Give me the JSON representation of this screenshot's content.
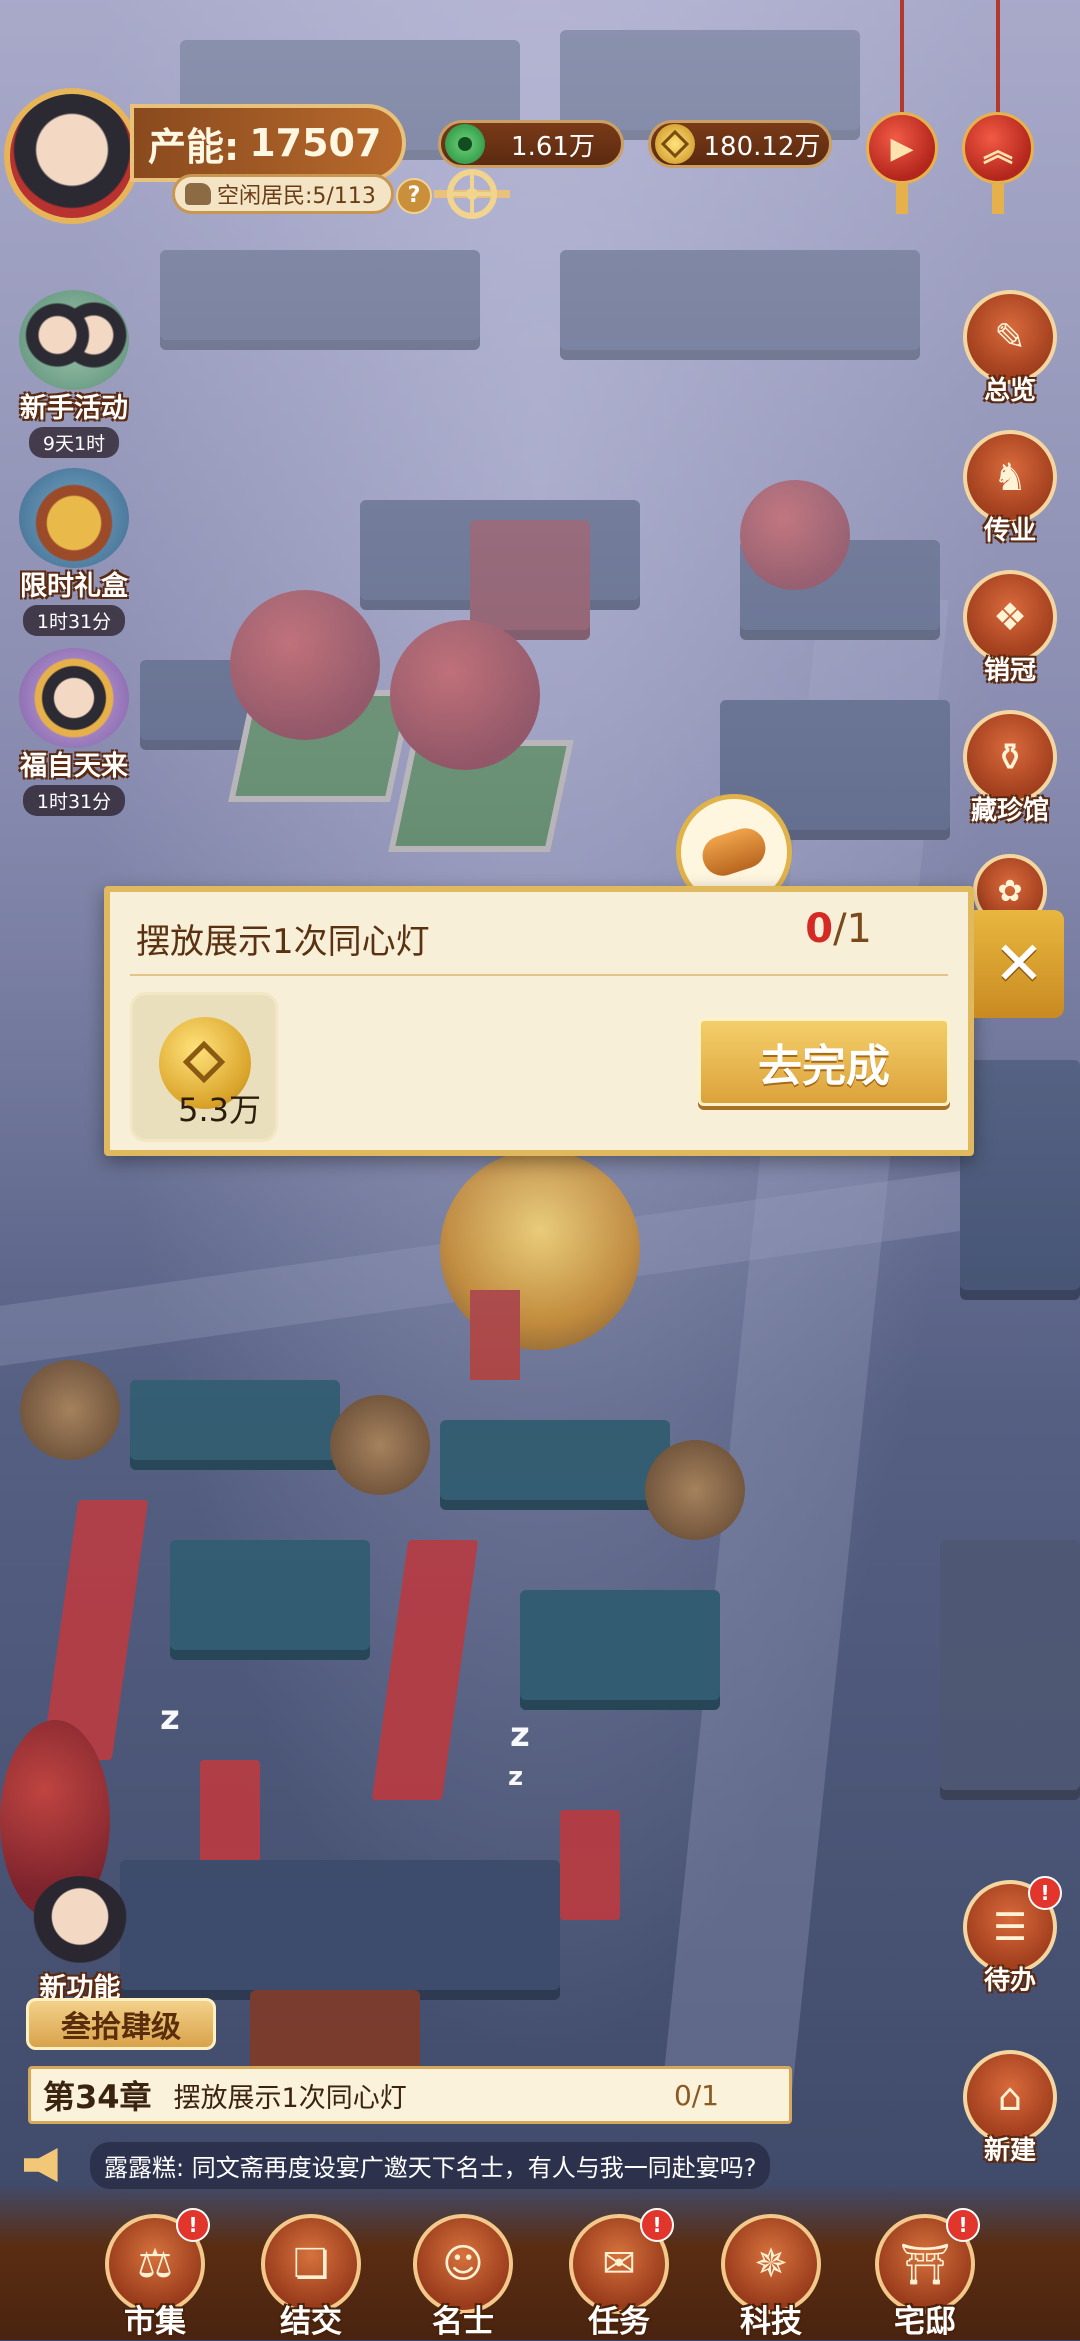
{
  "hud": {
    "production_label": "产能:",
    "production_value": "17507",
    "idle_residents": "空闲居民:5/113",
    "help": "?",
    "currency_green": "1.61万",
    "currency_gold": "180.12万",
    "lantern_icons": [
      "video-icon",
      "up-arrow-icon"
    ]
  },
  "left_events": [
    {
      "name": "新手活动",
      "time": "9天1时"
    },
    {
      "name": "限时礼盒",
      "time": "1时31分"
    },
    {
      "name": "福自天来",
      "time": "1时31分"
    }
  ],
  "right_menu": [
    {
      "name": "总览"
    },
    {
      "name": "传业"
    },
    {
      "name": "销冠"
    },
    {
      "name": "藏珍馆"
    },
    {
      "name": "待办"
    },
    {
      "name": "新建"
    }
  ],
  "task_popup": {
    "title": "摆放展示1次同心灯",
    "progress_current": "0",
    "progress_total": "/1",
    "reward_amount": "5.3万",
    "button": "去完成",
    "close": "✕"
  },
  "bottom": {
    "new_feature": "新功能",
    "level": "叁拾肆级",
    "chapter": "第34章",
    "chapter_task": "摆放展示1次同心灯",
    "chapter_progress": "0/1",
    "chat": "露露糕: 同文斋再度设宴广邀天下名士，有人与我一同赴宴吗?",
    "nav": [
      {
        "label": "市集",
        "badge": "!"
      },
      {
        "label": "结交",
        "badge": ""
      },
      {
        "label": "名士",
        "badge": ""
      },
      {
        "label": "任务",
        "badge": "!"
      },
      {
        "label": "科技",
        "badge": ""
      },
      {
        "label": "宅邸",
        "badge": "!"
      }
    ]
  },
  "colors": {
    "accent_gold": "#e0b85d",
    "progress_red": "#d52a24",
    "badge_red": "#e2362c"
  }
}
